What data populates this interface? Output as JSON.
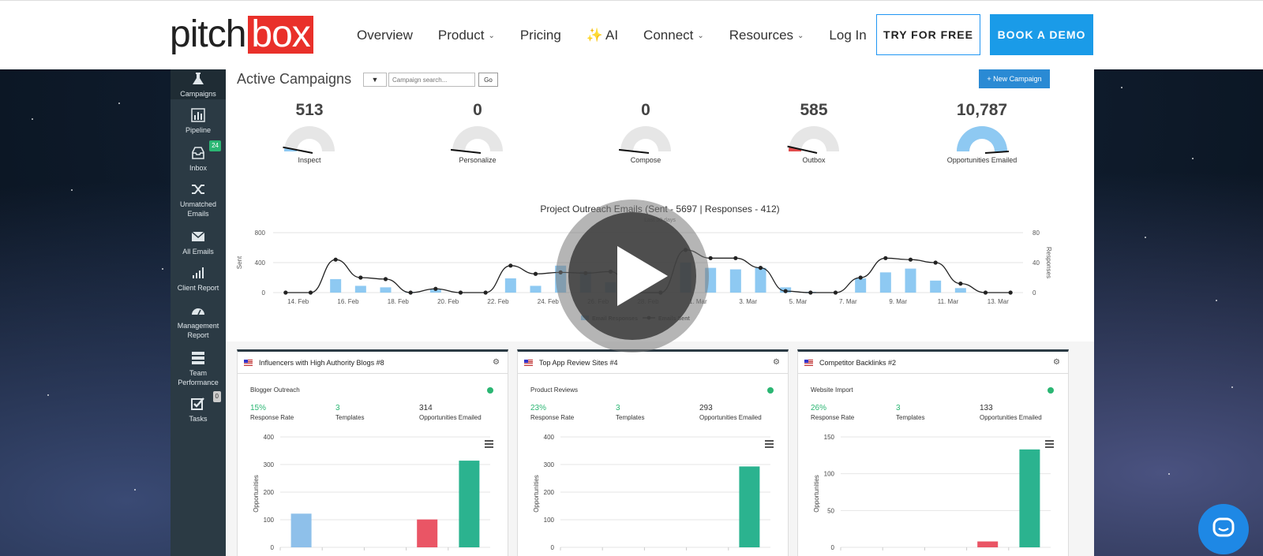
{
  "brand": {
    "part1": "pitch",
    "part2": "box"
  },
  "nav": [
    {
      "label": "Overview",
      "dropdown": false
    },
    {
      "label": "Product",
      "dropdown": true
    },
    {
      "label": "Pricing",
      "dropdown": false
    },
    {
      "label": "AI",
      "dropdown": false,
      "prefix": "✨"
    },
    {
      "label": "Connect",
      "dropdown": true
    },
    {
      "label": "Resources",
      "dropdown": true
    },
    {
      "label": "Log In",
      "dropdown": false
    }
  ],
  "cta": {
    "try": "TRY FOR FREE",
    "demo": "BOOK A DEMO"
  },
  "sidebar": [
    {
      "label": "Campaigns",
      "icon": "flask-icon"
    },
    {
      "label": "Pipeline",
      "icon": "bar-chart-icon"
    },
    {
      "label": "Inbox",
      "icon": "inbox-icon",
      "badge": "24"
    },
    {
      "label": "Unmatched Emails",
      "icon": "shuffle-icon"
    },
    {
      "label": "All Emails",
      "icon": "envelope-icon"
    },
    {
      "label": "Client Report",
      "icon": "signal-icon"
    },
    {
      "label": "Management Report",
      "icon": "dashboard-icon"
    },
    {
      "label": "Team Performance",
      "icon": "server-icon"
    },
    {
      "label": "Tasks",
      "icon": "checkbox-icon",
      "badge": "0"
    }
  ],
  "main": {
    "title": "Active Campaigns",
    "search_placeholder": "Campaign search...",
    "go": "Go",
    "new_campaign": "+ New Campaign"
  },
  "gauges": [
    {
      "value": "513",
      "label": "Inspect",
      "fraction": 0.05,
      "fill": "#8ec9f2"
    },
    {
      "value": "0",
      "label": "Personalize",
      "fraction": 0.0,
      "fill": "#8ec9f2"
    },
    {
      "value": "0",
      "label": "Compose",
      "fraction": 0.0,
      "fill": "#8ec9f2"
    },
    {
      "value": "585",
      "label": "Outbox",
      "fraction": 0.06,
      "fill": "#e14c4c"
    },
    {
      "value": "10,787",
      "label": "Opportunities Emailed",
      "fraction": 1.0,
      "fill": "#8ec9f2"
    }
  ],
  "chart_data": [
    {
      "type": "bar",
      "title": "Project Outreach Emails (Sent - 5697 | Responses - 412)",
      "subtitle": "Last 30 days",
      "ylabel": "Sent",
      "y2label": "Responses",
      "ylim": [
        0,
        800
      ],
      "y2lim": [
        0,
        80
      ],
      "yticks": [
        "0",
        "400",
        "800"
      ],
      "y2ticks": [
        "0",
        "40",
        "80"
      ],
      "xticks": [
        "14. Feb",
        "16. Feb",
        "18. Feb",
        "20. Feb",
        "22. Feb",
        "24. Feb",
        "26. Feb",
        "28. Feb",
        "1. Mar",
        "3. Mar",
        "5. Mar",
        "7. Mar",
        "9. Mar",
        "11. Mar",
        "13. Mar"
      ],
      "legend": [
        "Email Responses",
        "Emails Sent"
      ],
      "series": [
        {
          "name": "Email Responses",
          "type": "bar",
          "values": [
            0,
            0,
            18,
            9,
            7,
            1,
            4,
            0,
            0,
            19,
            9,
            36,
            28,
            14,
            0,
            0,
            40,
            33,
            31,
            33,
            7,
            1,
            0,
            19,
            27,
            32,
            16,
            6,
            0,
            0
          ]
        },
        {
          "name": "Emails Sent",
          "type": "line",
          "values": [
            0,
            0,
            440,
            200,
            180,
            0,
            50,
            0,
            0,
            360,
            250,
            270,
            260,
            280,
            0,
            0,
            570,
            460,
            460,
            330,
            20,
            0,
            0,
            200,
            460,
            440,
            400,
            120,
            0,
            0
          ]
        }
      ],
      "colors": {
        "bar": "#8ec9f2",
        "line": "#222222"
      }
    },
    {
      "type": "bar",
      "ylabel": "Opportunities",
      "ylim": [
        0,
        400
      ],
      "yticks": [
        "0",
        "100",
        "200",
        "300",
        "400"
      ],
      "values": [
        122,
        0,
        0,
        101,
        314
      ],
      "colors": [
        "#8ec0ea",
        "#8ec0ea",
        "#8ec0ea",
        "#ea5565",
        "#2bb38f"
      ]
    },
    {
      "type": "bar",
      "ylabel": "Opportunities",
      "ylim": [
        0,
        400
      ],
      "yticks": [
        "0",
        "100",
        "200",
        "300",
        "400"
      ],
      "values": [
        0,
        0,
        0,
        0,
        293
      ],
      "colors": [
        "#8ec0ea",
        "#8ec0ea",
        "#8ec0ea",
        "#ea5565",
        "#2bb38f"
      ]
    },
    {
      "type": "bar",
      "ylabel": "Opportunities",
      "ylim": [
        0,
        150
      ],
      "yticks": [
        "0",
        "50",
        "100",
        "150"
      ],
      "values": [
        0,
        0,
        0,
        8,
        133
      ],
      "colors": [
        "#8ec0ea",
        "#8ec0ea",
        "#8ec0ea",
        "#ea5565",
        "#2bb38f"
      ]
    }
  ],
  "panels": [
    {
      "title": "Influencers with High Authority Blogs #8",
      "type": "Blogger Outreach",
      "rate": "15%",
      "rate_label": "Response Rate",
      "templates": "3",
      "templates_label": "Templates",
      "opps": "314",
      "opps_label": "Opportunities Emailed"
    },
    {
      "title": "Top App Review Sites #4",
      "type": "Product Reviews",
      "rate": "23%",
      "rate_label": "Response Rate",
      "templates": "3",
      "templates_label": "Templates",
      "opps": "293",
      "opps_label": "Opportunities Emailed"
    },
    {
      "title": "Competitor Backlinks #2",
      "type": "Website Import",
      "rate": "26%",
      "rate_label": "Response Rate",
      "templates": "3",
      "templates_label": "Templates",
      "opps": "133",
      "opps_label": "Opportunities Emailed"
    }
  ]
}
